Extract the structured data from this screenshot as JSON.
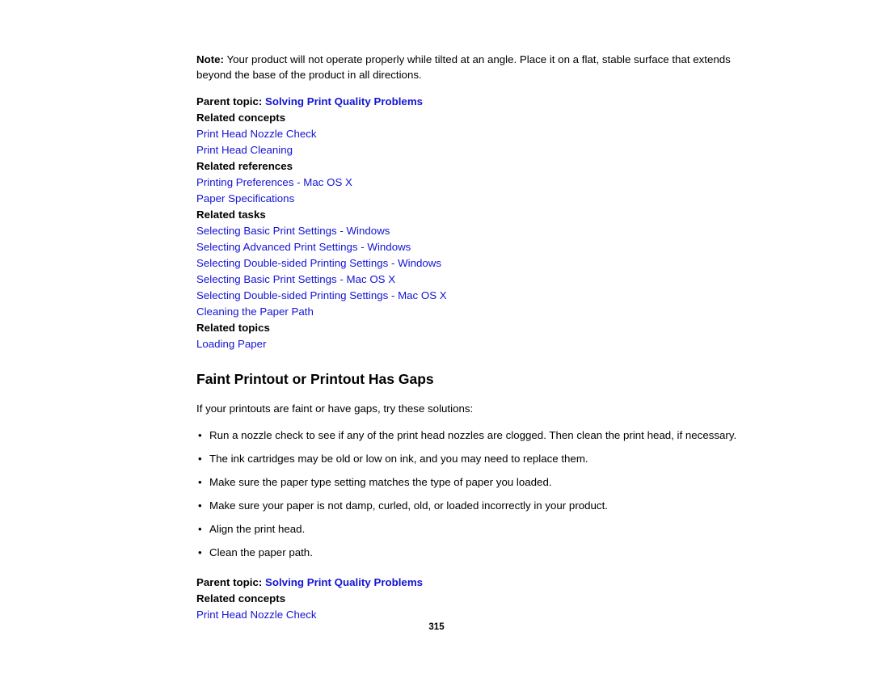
{
  "page": {
    "number": "315"
  },
  "note": {
    "label": "Note:",
    "text": " Your product will not operate properly while tilted at an angle. Place it on a flat, stable surface that extends beyond the base of the product in all directions."
  },
  "section1": {
    "parent_topic_label": "Parent topic:",
    "parent_topic_link": "Solving Print Quality Problems",
    "related_concepts_label": "Related concepts",
    "related_concepts": [
      "Print Head Nozzle Check",
      "Print Head Cleaning"
    ],
    "related_references_label": "Related references",
    "related_references": [
      "Printing Preferences - Mac OS X",
      "Paper Specifications"
    ],
    "related_tasks_label": "Related tasks",
    "related_tasks": [
      "Selecting Basic Print Settings - Windows",
      "Selecting Advanced Print Settings - Windows",
      "Selecting Double-sided Printing Settings - Windows",
      "Selecting Basic Print Settings - Mac OS X",
      "Selecting Double-sided Printing Settings - Mac OS X",
      "Cleaning the Paper Path"
    ],
    "related_topics_label": "Related topics",
    "related_topics": [
      "Loading Paper"
    ]
  },
  "section2": {
    "heading": "Faint Printout or Printout Has Gaps",
    "intro": "If your printouts are faint or have gaps, try these solutions:",
    "bullets": [
      "Run a nozzle check to see if any of the print head nozzles are clogged. Then clean the print head, if necessary.",
      "The ink cartridges may be old or low on ink, and you may need to replace them.",
      "Make sure the paper type setting matches the type of paper you loaded.",
      "Make sure your paper is not damp, curled, old, or loaded incorrectly in your product.",
      "Align the print head.",
      "Clean the paper path."
    ],
    "parent_topic_label": "Parent topic:",
    "parent_topic_link": "Solving Print Quality Problems",
    "related_concepts_label": "Related concepts",
    "related_concepts": [
      "Print Head Nozzle Check"
    ]
  }
}
